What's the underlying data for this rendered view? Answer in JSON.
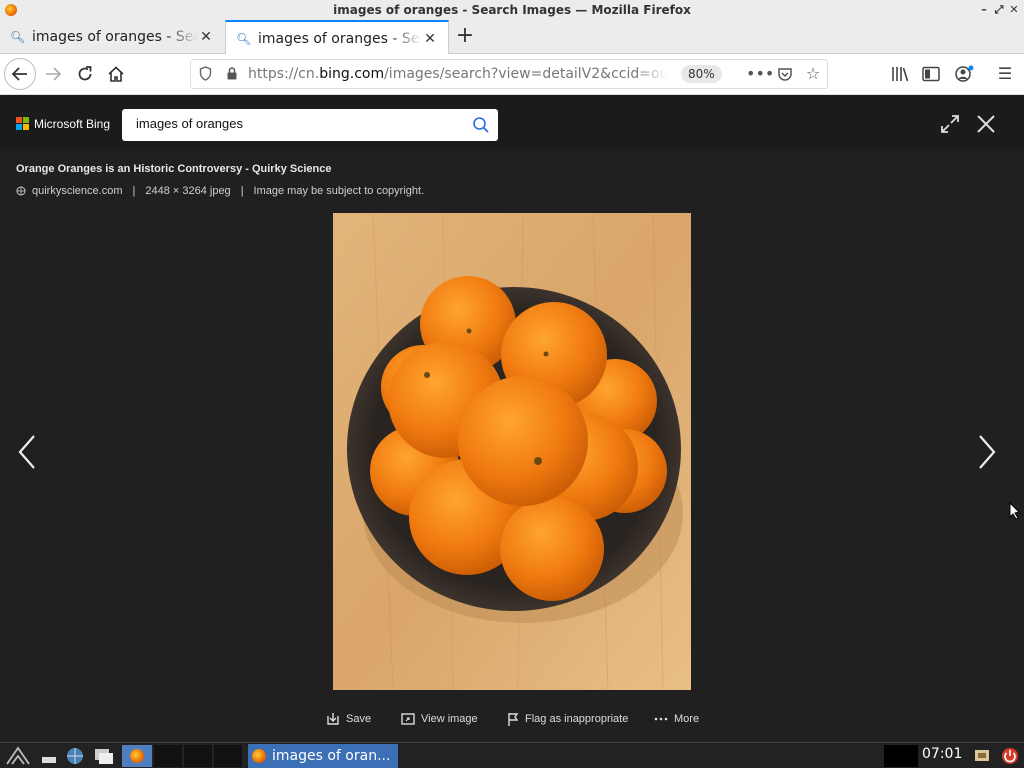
{
  "window": {
    "title": "images of oranges - Search Images — Mozilla Firefox"
  },
  "tabs": [
    {
      "label": "images of oranges - Search Images",
      "active": false
    },
    {
      "label": "images of oranges - Search Images",
      "active": true
    }
  ],
  "navbar": {
    "url_prefix": "https://cn.",
    "url_domain": "bing.com",
    "url_path": "/images/search?view=detailV2&ccid=ou0",
    "zoom": "80%"
  },
  "bing": {
    "brand": "Microsoft Bing",
    "search_value": "images of oranges",
    "logo_colors": [
      "#f25022",
      "#7fba00",
      "#00a4ef",
      "#ffb900"
    ]
  },
  "detail": {
    "title": "Orange Oranges is an Historic Controversy - Quirky Science",
    "source": "quirkyscience.com",
    "dimensions": "2448 × 3264 jpeg",
    "copyright": "Image may be subject to copyright."
  },
  "actions": {
    "save": "Save",
    "view_image": "View image",
    "flag": "Flag as inappropriate",
    "more": "More"
  },
  "taskbar": {
    "window_label": "images of oran...",
    "clock": "07:01"
  },
  "colors": {
    "accent": "#0a84ff",
    "page_bg": "#202020",
    "taskbar_active": "#3b6fb6"
  }
}
